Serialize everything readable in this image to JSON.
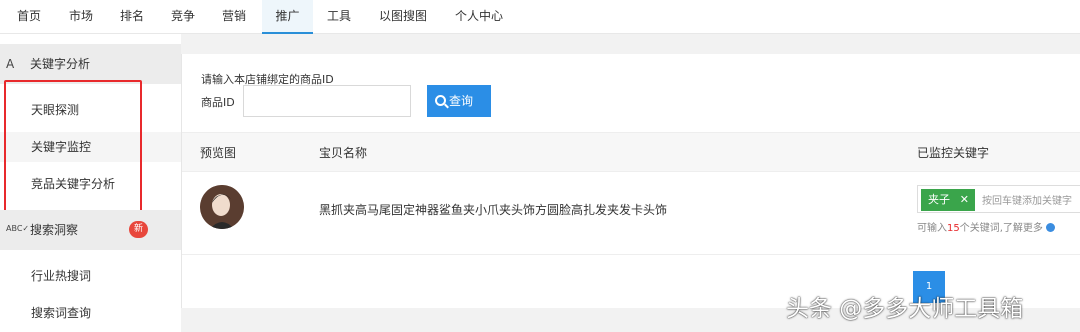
{
  "nav": {
    "items": [
      "首页",
      "市场",
      "排名",
      "竞争",
      "营销",
      "推广",
      "工具",
      "以图搜图",
      "个人中心"
    ],
    "active": "推广"
  },
  "sidebar": {
    "section1": {
      "icon": "A",
      "label": "关键字分析"
    },
    "section1_items": [
      "天眼探测",
      "关键字监控",
      "竞品关键字分析"
    ],
    "section2": {
      "icon": "ABC✓",
      "label": "搜索洞察",
      "badge": "新"
    },
    "section2_items": [
      "行业热搜词",
      "搜索词查询"
    ]
  },
  "form": {
    "hint": "请输入本店铺绑定的商品ID",
    "id_label": "商品ID",
    "id_value": "",
    "search_button": "查询"
  },
  "table": {
    "headers": [
      "预览图",
      "宝贝名称",
      "已监控关键字"
    ],
    "rows": [
      {
        "name": "黑抓夹高马尾固定神器鲨鱼夹小爪夹头饰方圆脸高扎发夹发卡头饰",
        "keyword_tag": "夹子",
        "keyword_placeholder": "按回车键添加关键字",
        "note_prefix": "可输入",
        "note_count": "15",
        "note_suffix": "个关键词,了解更多"
      }
    ]
  },
  "pagination": {
    "current": "1"
  },
  "watermark": "头条 @多多大师工具箱",
  "colors": {
    "accent": "#2b8ee6",
    "highlight_box": "#e8292c",
    "tag": "#3aa54b"
  }
}
